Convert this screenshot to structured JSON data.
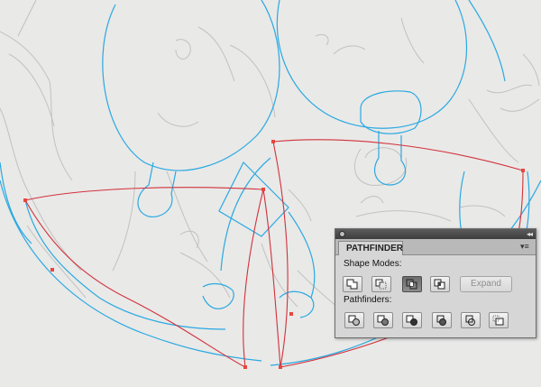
{
  "panel": {
    "tab_label": "PATHFINDER",
    "collapse_glyph": "◂◂",
    "menu_glyph": "▾≡",
    "shape_modes_label": "Shape Modes:",
    "pathfinders_label": "Pathfinders:",
    "expand_label": "Expand",
    "expand_enabled": false,
    "shape_mode_buttons": [
      "unite",
      "minus-front",
      "intersect",
      "exclude"
    ],
    "pressed_shape_mode": "intersect",
    "pathfinder_buttons": [
      "divide",
      "trim",
      "merge",
      "crop",
      "outline",
      "minus-back"
    ]
  },
  "colors": {
    "canvas_background": "#e9e9e8",
    "guide_path": "#29a9e1",
    "selected_path": "#d2313a",
    "anchor_point": "#e8463f",
    "pencil_sketch": "#b8b8b8"
  }
}
